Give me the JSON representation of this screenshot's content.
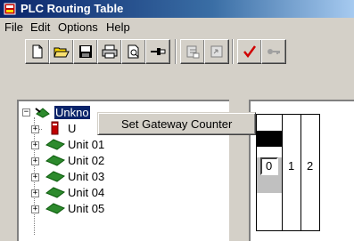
{
  "window": {
    "title": "PLC Routing Table",
    "icon": "plc-icon"
  },
  "menu": [
    "File",
    "Edit",
    "Options",
    "Help"
  ],
  "toolbar": {
    "buttons": [
      {
        "name": "new-icon"
      },
      {
        "name": "open-folder-icon"
      },
      {
        "name": "save-icon"
      },
      {
        "name": "print-icon"
      },
      {
        "name": "print-preview-icon"
      },
      {
        "name": "pin-icon"
      },
      {
        "name": "transfer-to-plc-icon"
      },
      {
        "name": "transfer-from-plc-icon"
      },
      {
        "name": "checkmark-icon"
      },
      {
        "name": "key-icon"
      }
    ]
  },
  "tree": {
    "root_label": "Unknown",
    "root_label_visible": "Unkno",
    "items": [
      "U",
      "Unit 01",
      "Unit 02",
      "Unit 03",
      "Unit 04",
      "Unit 05"
    ]
  },
  "context_menu": {
    "items": [
      "Set Gateway Counter"
    ]
  },
  "slots": [
    "0",
    "1",
    "2"
  ],
  "colors": {
    "title_start": "#0a246a",
    "title_end": "#a6caf0",
    "selection": "#0a246a",
    "unit_green": "#2d8a2d"
  }
}
